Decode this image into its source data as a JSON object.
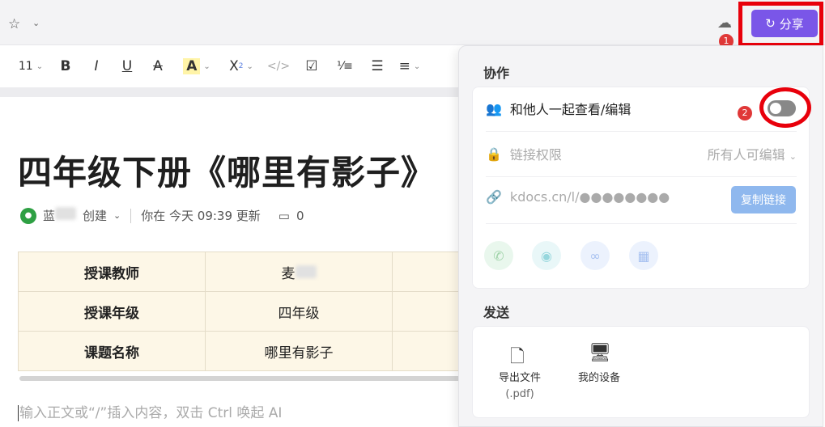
{
  "topbar": {
    "share_label": "分享",
    "badge_share": "1"
  },
  "toolbar": {
    "font_size": "11",
    "bold": "B",
    "italic": "I",
    "underline": "U",
    "strike": "A",
    "highlight": "A",
    "superscript": "X",
    "superscript_mark": "2",
    "code": "</>"
  },
  "document": {
    "title": "四年级下册《哪里有影子》",
    "author_prefix": "蓝",
    "created": "创建",
    "updated": "你在 今天 09:39 更新",
    "comment_count": "0",
    "table": [
      [
        "授课教师",
        "麦",
        ""
      ],
      [
        "授课年级",
        "四年级",
        ""
      ],
      [
        "课题名称",
        "哪里有影子",
        ""
      ]
    ],
    "placeholder": "输入正文或“/”插入内容，双击 Ctrl 唤起 AI"
  },
  "panel": {
    "collab_title": "协作",
    "collab_label": "和他人一起查看/编辑",
    "badge_toggle": "2",
    "toggle_on": false,
    "link_perm_label": "链接权限",
    "link_perm_value": "所有人可编辑",
    "link_url": "kdocs.cn/l/●●●●●●●●",
    "copy_label": "复制链接",
    "send_title": "发送",
    "export_label": "导出文件",
    "export_sub": "(.pdf)",
    "device_label": "我的设备"
  },
  "colors": {
    "share_button": "#7a56e8",
    "highlight_outline": "#e8000b",
    "copy_button": "#8fb8ee"
  }
}
